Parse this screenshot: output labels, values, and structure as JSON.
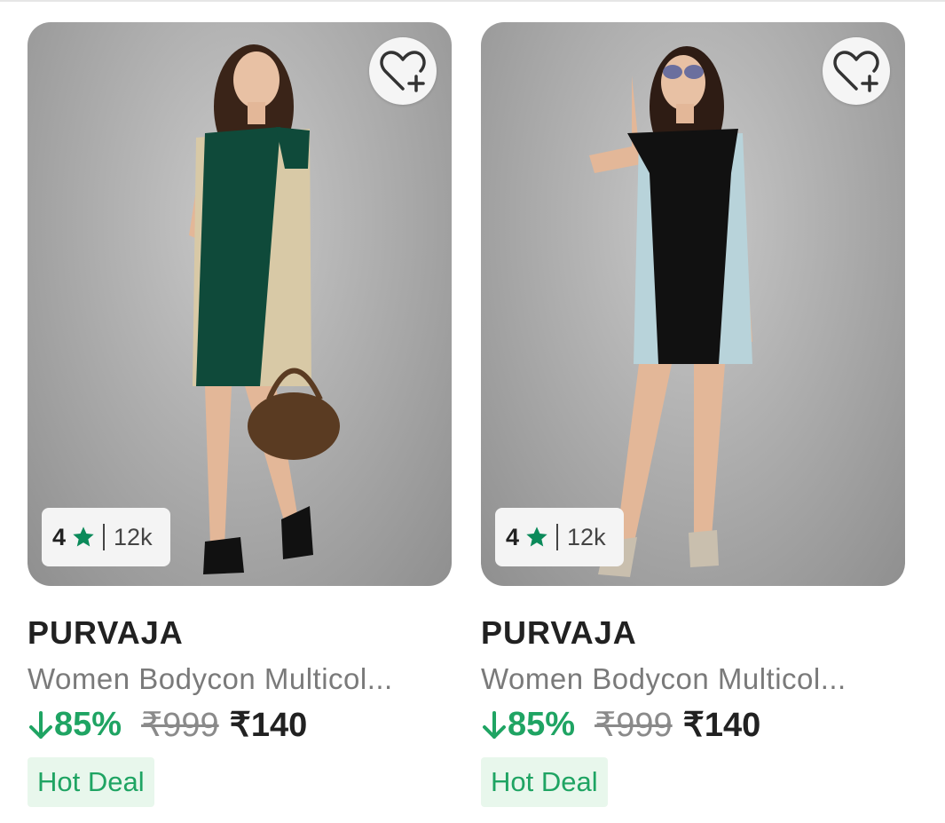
{
  "products": [
    {
      "rating": "4",
      "rating_count": "12k",
      "brand": "PURVAJA",
      "title": "Women Bodycon Multicol...",
      "discount": "85%",
      "mrp": "₹999",
      "price": "₹140",
      "badge": "Hot Deal",
      "dress_colors": {
        "main": "#0f4a3a",
        "side": "#d8c9a6"
      }
    },
    {
      "rating": "4",
      "rating_count": "12k",
      "brand": "PURVAJA",
      "title": "Women Bodycon Multicol...",
      "discount": "85%",
      "mrp": "₹999",
      "price": "₹140",
      "badge": "Hot Deal",
      "dress_colors": {
        "main": "#111111",
        "side": "#b8d3da"
      }
    }
  ],
  "colors": {
    "accent_green": "#1fa463",
    "star_green": "#0b8a5a"
  }
}
